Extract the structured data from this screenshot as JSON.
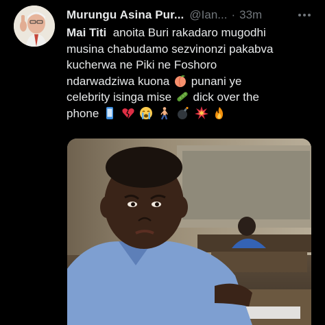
{
  "author": {
    "display_name": "Murungu Asina Pur...",
    "handle": "@Ian...",
    "separator": "·",
    "time": "33m"
  },
  "icons": {
    "avatar": "avatar-photo",
    "more": "more-dots-icon"
  },
  "tweet": {
    "mention": "Mai Titi",
    "line1_rest": "anoita Buri rakadaro mugodhi",
    "line2": "musina chabudamo sezvinonzi pakabva",
    "line3": "kucherwa ne Piki ne Foshoro",
    "line4_a": "ndarwadziwa kuona",
    "line4_b": "punani ye",
    "line5_a": "celebrity isinga mise",
    "line5_b": "dick over the",
    "line6": "phone",
    "emojis": [
      "peach",
      "cucumber",
      "mobile-phone",
      "broken-heart",
      "loudly-crying-face",
      "person-walking",
      "bomb",
      "collision",
      "fire"
    ]
  },
  "media": {
    "description_icon": "photo-boy-in-classroom"
  },
  "colors": {
    "background": "#000000",
    "text": "#e7e9ea",
    "muted": "#71767b"
  }
}
